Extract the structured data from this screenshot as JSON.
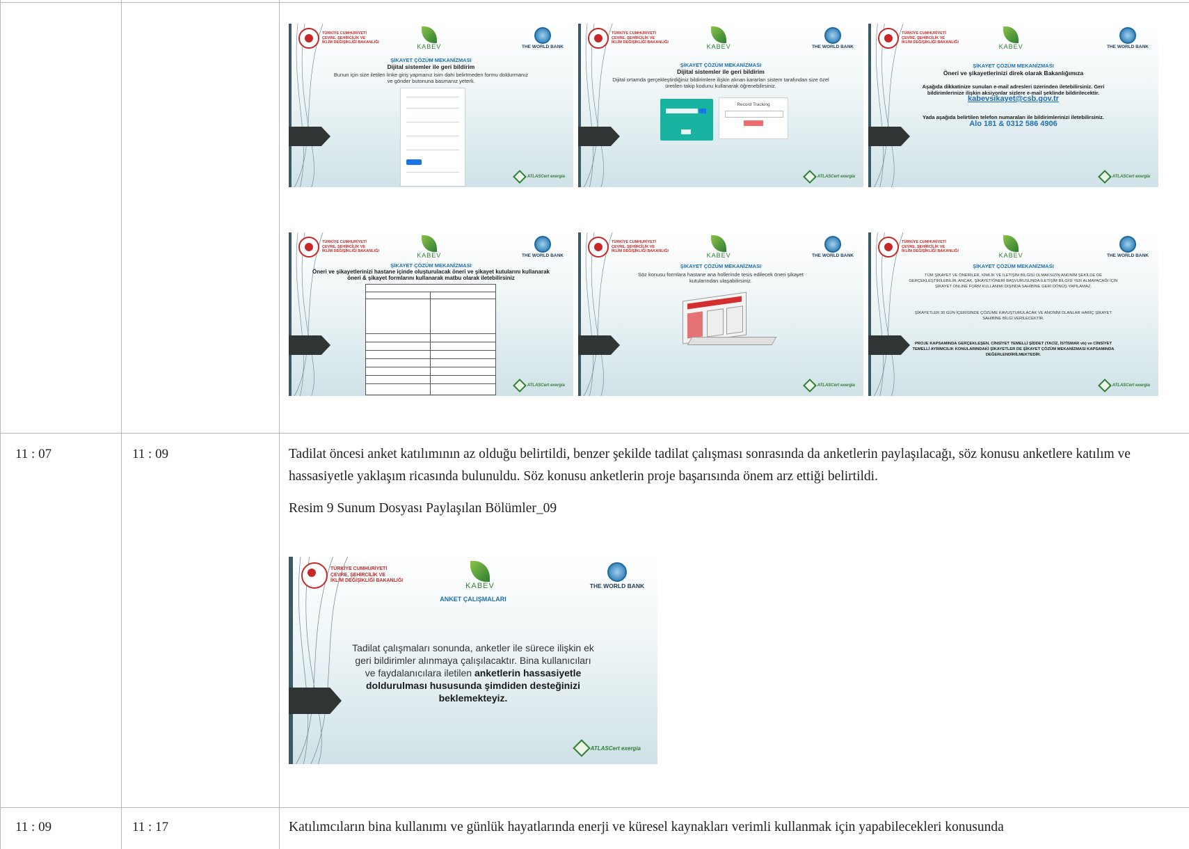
{
  "rows": [
    {
      "start": "",
      "end": ""
    },
    {
      "start": "11 : 07",
      "end": "11 : 09",
      "text": "Tadilat öncesi anket katılımının az olduğu belirtildi, benzer şekilde tadilat çalışması sonrasında da anketlerin paylaşılacağı, söz konusu anketlere katılım ve hassasiyetle yaklaşım ricasında bulunuldu. Söz konusu anketlerin proje başarısında önem arz ettiği belirtildi.",
      "caption": "Resim 9 Sunum Dosyası Paylaşılan Bölümler_09"
    },
    {
      "start": "11 : 09",
      "end": "11 : 17",
      "text": "Katılımcıların bina kullanımı ve günlük hayatlarında enerji ve küresel kaynakları verimli kullanmak için yapabilecekleri konusunda"
    }
  ],
  "branding": {
    "ministry": [
      "TÜRKİYE CUMHURİYETİ",
      "ÇEVRE, ŞEHİRCİLİK VE",
      "İKLİM DEĞİŞİKLİĞİ BAKANLIĞI"
    ],
    "kabev": "KABEV",
    "worldbank": "THE WORLD BANK",
    "footer": "ATLASCert  exergia"
  },
  "slides": [
    {
      "title": "ŞİKAYET ÇÖZÜM MEKANİZMASI",
      "heading": "Dijital sistemler ile geri bildirim",
      "body": "Bunun için size iletilen linke giriş yapmanız isim dahi belirtmeden formu doldurmanız ve gönder butonuna basmanız yeterli."
    },
    {
      "title": "ŞİKAYET ÇÖZÜM MEKANİZMASI",
      "heading": "Dijital sistemler ile geri bildirim",
      "body": "Dijital ortamda gerçekleştirdiğiniz bildirimlere ilişkin alınan kararları sistem tarafından size özel üretilen takip kodunu kullanarak öğrenebilirsiniz.",
      "record_tracking": "Record Tracking"
    },
    {
      "title": "ŞİKAYET ÇÖZÜM MEKANİZMASI",
      "heading": "Öneri ve şikayetlerinizi direk olarak Bakanlığımıza",
      "body": "Aşağıda dikkatinize sunulan e-mail adresleri üzerinden iletebilirsiniz. Geri bildirimlerinize ilişkin aksiyonlar sizlere e-mail şeklinde bildirilecektir.",
      "email": "kabevsikayet@csb.gov.tr",
      "body2": "Yada aşağıda belirtilen telefon numaraları ile bildirimlerinizi iletebilirsiniz.",
      "phone": "Alo 181 & 0312 586 4906"
    },
    {
      "title": "ŞİKAYET ÇÖZÜM MEKANİZMASI",
      "heading": "Öneri ve şikayetlerinizi hastane içinde oluşturulacak öneri ve şikayet kutularını kullanarak öneri & şikayet formlarını kullanarak matbu olarak iletebilirsiniz"
    },
    {
      "title": "ŞİKAYET ÇÖZÜM MEKANİZMASI",
      "body": "Söz konusu formlara hastane ana hollerinde tesis edilecek öneri şikayet kutularından ulaşabilirsiniz."
    },
    {
      "title": "ŞİKAYET ÇÖZÜM MEKANİZMASI",
      "p1": "TÜM ŞİKAYET VE ÖNERİLER, KİMLİK VE İLETİŞİM BİLGİSİ OLMAKSIZIN ANONİM ŞEKİLDE DE GERÇEKLEŞTİRİLEBİLİR. ANCAK, ŞİKAYET/ÖNERİ BAŞVURUSUNDA İLETİŞİM BİLGİSİ YER ALMAYACAĞI İÇİN ŞİKAYET ONLINE FORM KULLANIMI DIŞINDA SAHİBİNE GERİ DÖNÜŞ YAPILAMAZ.",
      "p2": "ŞİKAYETLER 30 GÜN İÇERİSİNDE ÇÖZÜME KAVUŞTURULACAK VE ANONİM OLANLAR HARİÇ ŞİKAYET SAHİBİNE BİLGİ VERİLECEKTİR.",
      "p3": "PROJE KAPSAMINDA GERÇEKLEŞEN, CİNSİYET TEMELLİ ŞİDDET (TACİZ, İSTİSMAR vb) ve CİNSİYET TEMELLİ AYRIMCILIK KONULARINDAKİ ŞİKAYETLER DE ŞİKAYET ÇÖZÜM MEKANİZMASI KAPSAMINDA DEĞERLENDİRİLMEKTEDİR."
    },
    {
      "title": "ANKET ÇALIŞMALARI",
      "body": "Tadilat çalışmaları sonunda, anketler ile sürece ilişkin ek geri bildirimler alınmaya çalışılacaktır. Bina kullanıcıları ve faydalanıcılara iletilen",
      "bold": "anketlerin hassasiyetle doldurulması hususunda şimdiden desteğinizi beklemekteyiz."
    }
  ]
}
